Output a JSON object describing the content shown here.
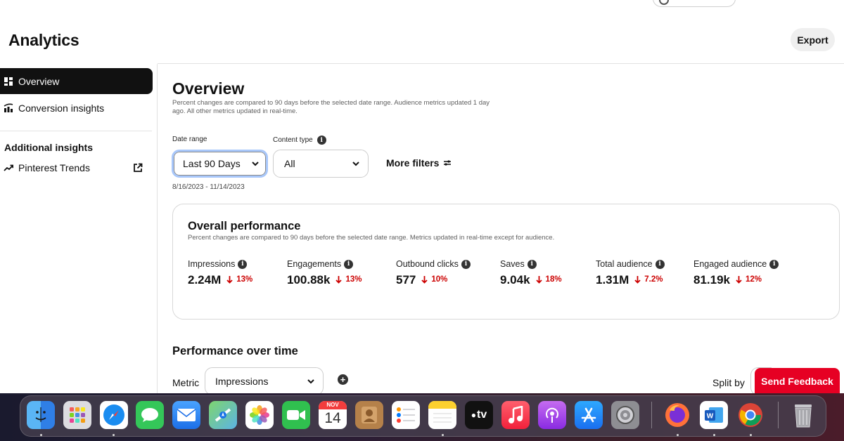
{
  "header": {
    "title": "Analytics",
    "export_label": "Export"
  },
  "sidebar": {
    "items": [
      {
        "label": "Overview",
        "icon": "dashboard-icon",
        "active": true
      },
      {
        "label": "Conversion insights",
        "icon": "conversion-chart-icon",
        "active": false
      }
    ],
    "section_heading": "Additional insights",
    "trends_label": "Pinterest Trends"
  },
  "overview": {
    "title": "Overview",
    "subtitle": "Percent changes are compared to 90 days before the selected date range. Audience metrics updated 1 day ago. All other metrics updated in real-time."
  },
  "filters": {
    "date_range_label": "Date range",
    "date_range_value": "Last 90 Days",
    "content_type_label": "Content type",
    "content_type_value": "All",
    "more_filters_label": "More filters",
    "date_span": "8/16/2023 - 11/14/2023"
  },
  "performance": {
    "title": "Overall performance",
    "subtitle": "Percent changes are compared to 90 days before the selected date range. Metrics updated in real-time except for audience.",
    "metrics": [
      {
        "label": "Impressions",
        "value": "2.24M",
        "change": "13%",
        "direction": "down"
      },
      {
        "label": "Engagements",
        "value": "100.88k",
        "change": "13%",
        "direction": "down"
      },
      {
        "label": "Outbound clicks",
        "value": "577",
        "change": "10%",
        "direction": "down"
      },
      {
        "label": "Saves",
        "value": "9.04k",
        "change": "18%",
        "direction": "down"
      },
      {
        "label": "Total audience",
        "value": "1.31M",
        "change": "7.2%",
        "direction": "down"
      },
      {
        "label": "Engaged audience",
        "value": "81.19k",
        "change": "12%",
        "direction": "down"
      }
    ]
  },
  "over_time": {
    "title": "Performance over time",
    "metric_label": "Metric",
    "metric_value": "Impressions",
    "split_label": "Split by",
    "feedback_label": "Send Feedback"
  },
  "dock": {
    "calendar_month": "NOV",
    "calendar_day": "14",
    "tv_label": "tv",
    "apps": [
      "finder-icon",
      "launchpad-icon",
      "safari-icon",
      "messages-icon",
      "mail-icon",
      "maps-icon",
      "photos-icon",
      "facetime-icon",
      "calendar-icon",
      "contacts-icon",
      "reminders-icon",
      "notes-icon",
      "apple-tv-icon",
      "music-icon",
      "podcasts-icon",
      "app-store-icon",
      "system-settings-icon",
      "firefox-icon",
      "word-icon",
      "chrome-icon",
      "trash-icon"
    ]
  },
  "colors": {
    "accent_red": "#e60023",
    "change_red": "#cc0000",
    "focus_blue": "#a8c7fa",
    "active_nav": "#111111"
  }
}
